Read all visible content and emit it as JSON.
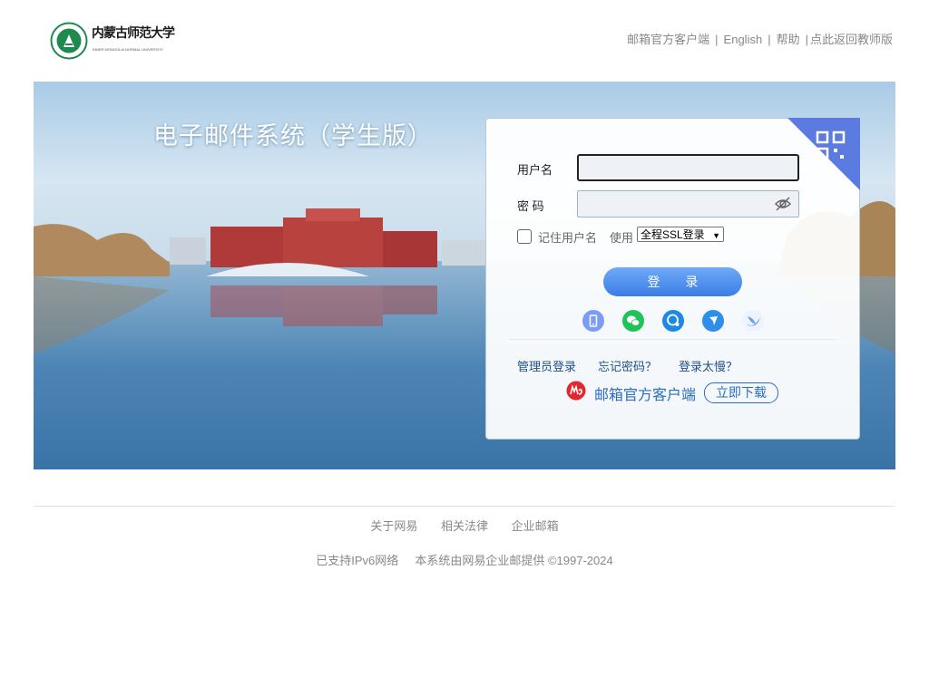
{
  "header": {
    "logo_text": "内蒙古师范大学",
    "logo_subtitle": "INNER MONGOLIA NORMAL UNIVERSITY",
    "links": [
      "邮箱官方客户端",
      "English",
      "帮助",
      "点此返回教师版"
    ]
  },
  "banner": {
    "title": "电子邮件系统（学生版）"
  },
  "login": {
    "username_label": "用户名",
    "username_value": "",
    "password_label": "密 码",
    "password_value": "",
    "remember_label": "记住用户名",
    "use_label": "使用",
    "ssl_option": "全程SSL登录",
    "submit_label": "登 录",
    "quick_icons": [
      "phone-icon",
      "wechat-icon",
      "chat-bubble-icon",
      "pin-icon",
      "popo-icon"
    ],
    "admin_login": "管理员登录",
    "forgot_password": "忘记密码？",
    "slow_login": "登录太慢？",
    "client_label": "邮箱官方客户端",
    "download_label": "立即下载"
  },
  "footer": {
    "links": [
      "关于网易",
      "相关法律",
      "企业邮箱"
    ],
    "ipv6": "已支持IPv6网络",
    "copyright": "本系统由网易企业邮提供 ©1997-2024"
  },
  "colors": {
    "accent": "#3a7de6",
    "qr_corner": "#5b7be0",
    "link": "#1f4f8a"
  }
}
